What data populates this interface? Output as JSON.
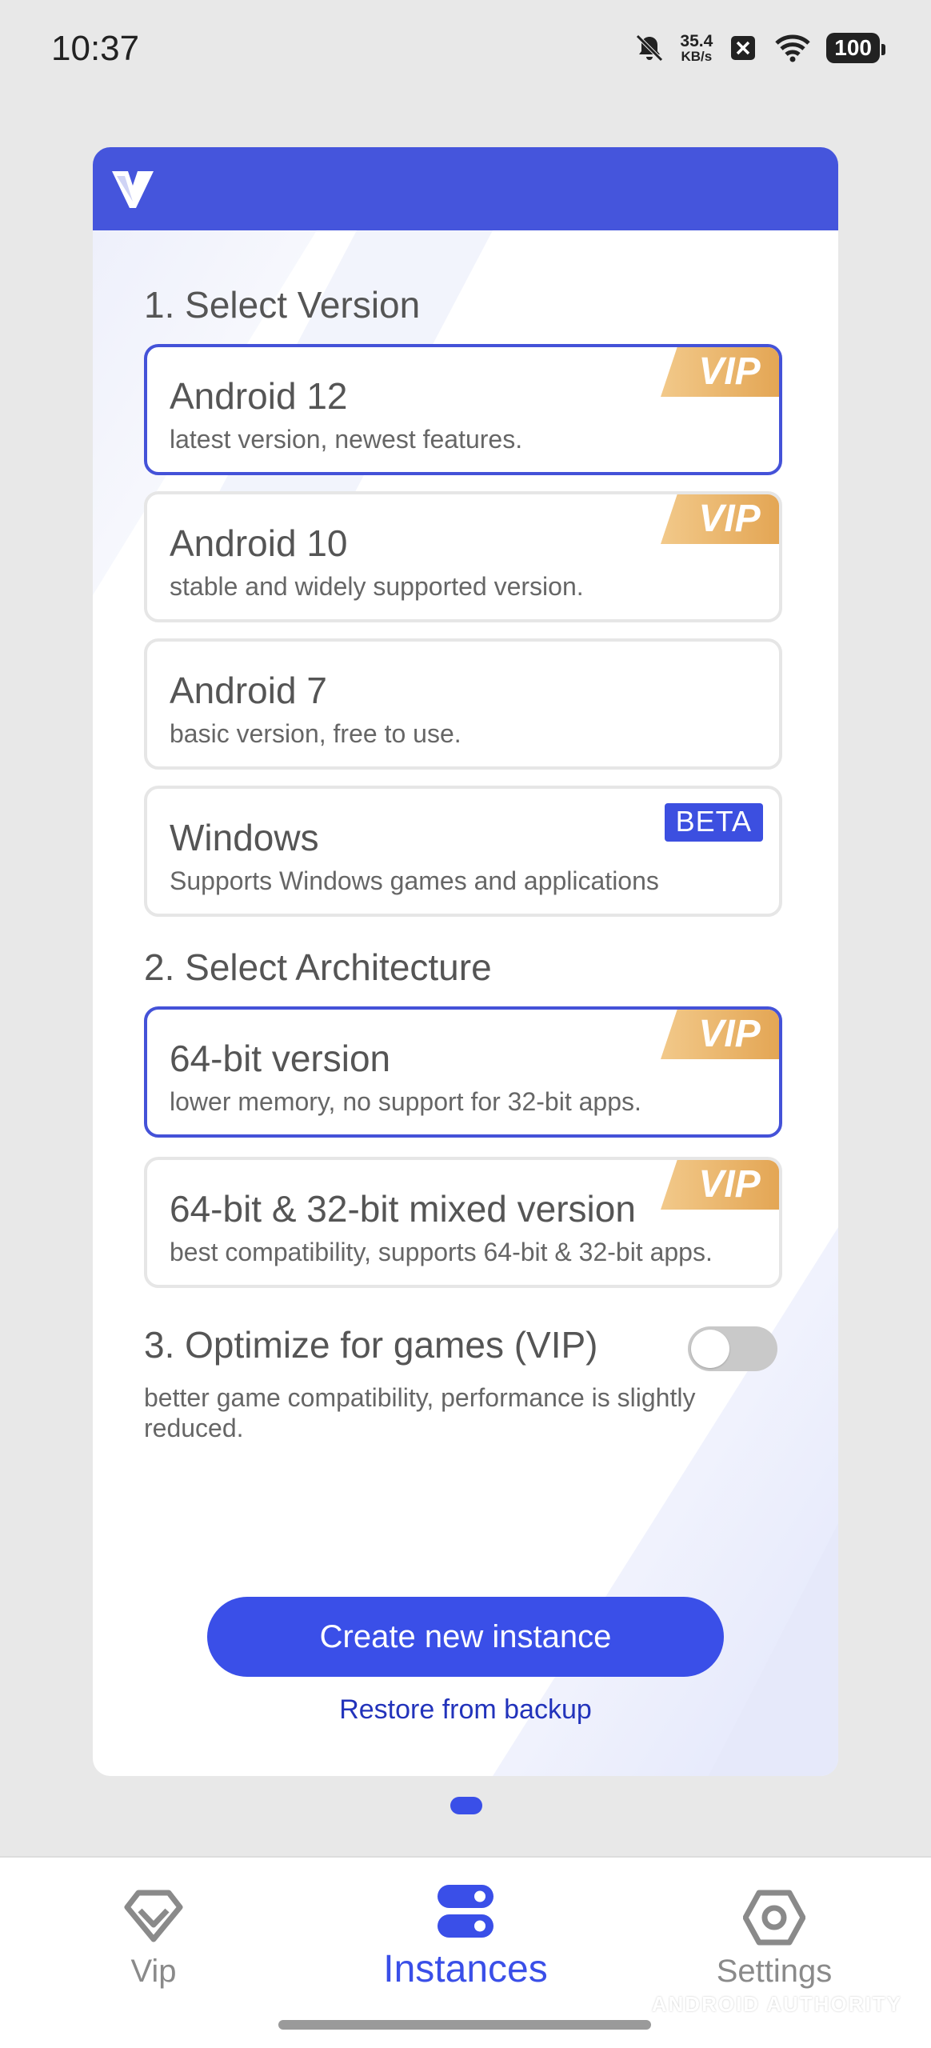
{
  "status_bar": {
    "time": "10:37",
    "net_speed_value": "35.4",
    "net_speed_unit": "KB/s",
    "battery": "100",
    "icons": [
      "bell-off-icon",
      "x-box-icon",
      "wifi-icon",
      "battery-icon"
    ]
  },
  "card": {
    "header_color": "#4555dc",
    "logo_icon": "v-logo-icon",
    "section1_title": "1. Select Version",
    "versions": [
      {
        "title": "Android 12",
        "subtitle": "latest version, newest features.",
        "badge": "VIP",
        "selected": true
      },
      {
        "title": "Android 10",
        "subtitle": "stable and widely supported version.",
        "badge": "VIP",
        "selected": false
      },
      {
        "title": "Android 7",
        "subtitle": "basic version, free to use.",
        "badge": "",
        "selected": false
      },
      {
        "title": "Windows",
        "subtitle": "Supports Windows games and applications",
        "badge": "BETA",
        "selected": false
      }
    ],
    "section2_title": "2. Select Architecture",
    "architectures": [
      {
        "title": "64-bit version",
        "subtitle": "lower memory, no support for 32-bit apps.",
        "badge": "VIP",
        "selected": true
      },
      {
        "title": "64-bit & 32-bit mixed version",
        "subtitle": "best compatibility, supports 64-bit & 32-bit apps.",
        "badge": "VIP",
        "selected": false
      }
    ],
    "section3_title": "3. Optimize for games (VIP)",
    "optimize_enabled": false,
    "optimize_desc": "better game compatibility, performance is slightly reduced.",
    "create_button": "Create new instance",
    "restore_link": "Restore from backup"
  },
  "bottom_nav": {
    "items": [
      {
        "label": "Vip",
        "icon": "diamond-icon",
        "active": false
      },
      {
        "label": "Instances",
        "icon": "instances-icon",
        "active": true
      },
      {
        "label": "Settings",
        "icon": "hexagon-settings-icon",
        "active": false
      }
    ]
  },
  "watermark": "ANDROID AUTHORITY",
  "colors": {
    "accent": "#3a4fe8",
    "vip_gold": "#e4a84e",
    "beta": "#3c4fe0"
  }
}
